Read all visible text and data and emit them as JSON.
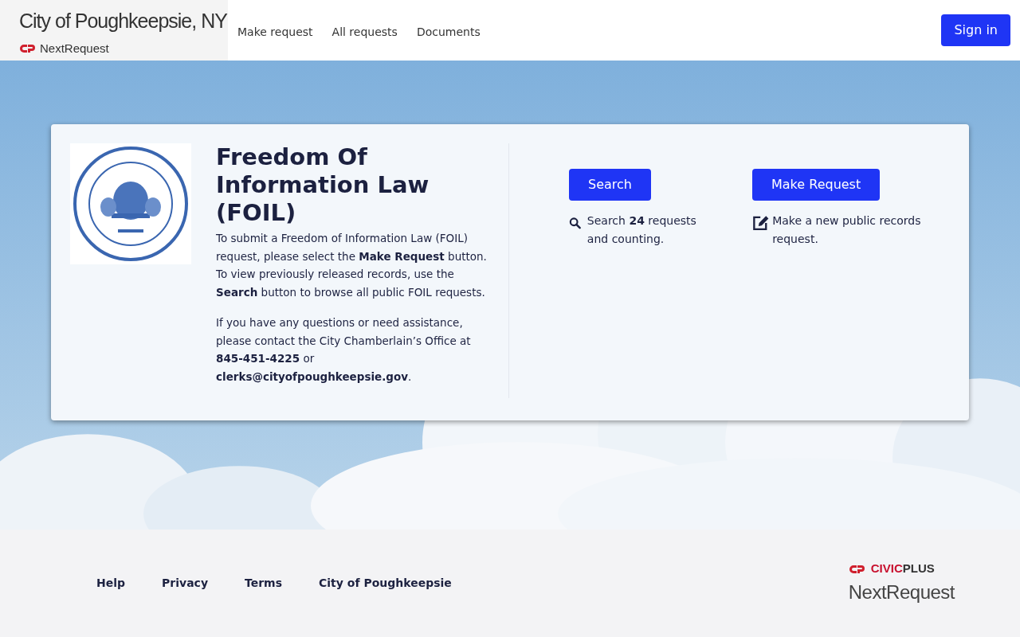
{
  "header": {
    "site_title": "City of Poughkeepsie, NY",
    "product": "NextRequest",
    "nav": [
      {
        "label": "Make request"
      },
      {
        "label": "All requests"
      },
      {
        "label": "Documents"
      }
    ],
    "sign_in": "Sign in"
  },
  "hero": {
    "background": {
      "kind": "picture"
    },
    "seal": {
      "kind": "picture"
    },
    "title": "Freedom Of Information Law (FOIL)",
    "paragraphs": [
      "To submit a Freedom of Information Law (FOIL) request, please select the **Make Request** button. To view previously released records, use the **Search** button to browse all public FOIL requests.",
      "If you have any questions or need assistance, please contact the City Chamberlain’s Office at **845-451-4225** or **clerks@cityofpoughkeepsie.gov**."
    ],
    "actions": [
      {
        "button": "Search",
        "kind": "search",
        "caption": "Search **24** requests and counting."
      },
      {
        "button": "Make Request",
        "kind": "edit",
        "caption": "Make a new public records request."
      }
    ]
  },
  "footer": {
    "links": [
      {
        "label": "Help"
      },
      {
        "label": "Privacy"
      },
      {
        "label": "Terms"
      },
      {
        "label": "City of Poughkeepsie"
      }
    ],
    "brand_parts": [
      "CIVIC",
      "PLUS"
    ],
    "product": "NextRequest"
  }
}
